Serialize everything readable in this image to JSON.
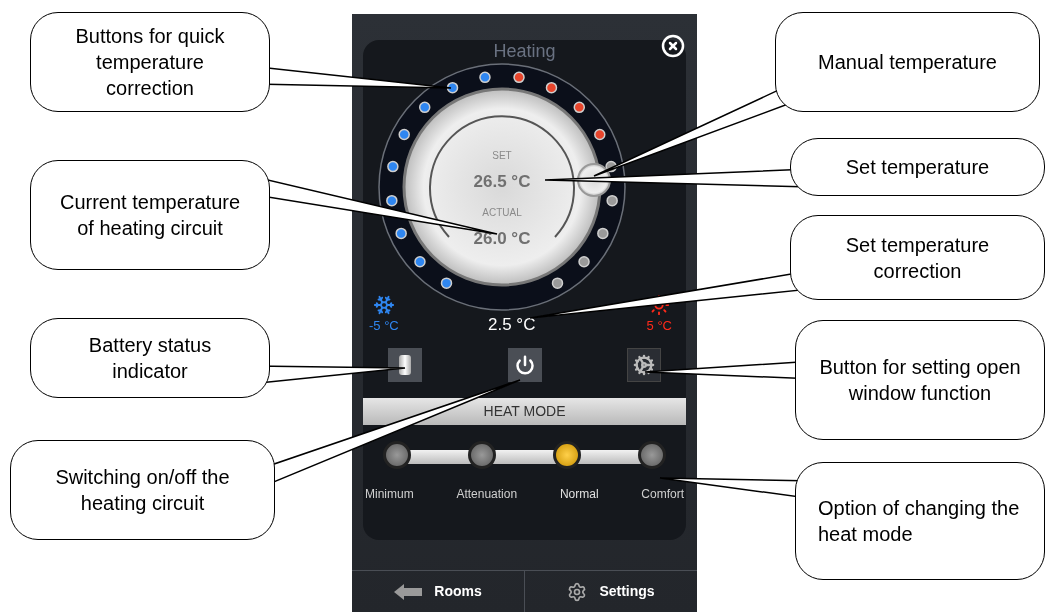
{
  "title": "Heating",
  "dial": {
    "set_label": "SET",
    "set_value": "26.5 °C",
    "actual_label": "ACTUAL",
    "actual_value": "26.0 °C",
    "correction": "2.5 °C",
    "dots": [
      {
        "color": "#2f86f0"
      },
      {
        "color": "#2f86f0"
      },
      {
        "color": "#2f86f0"
      },
      {
        "color": "#2f86f0"
      },
      {
        "color": "#2f86f0"
      },
      {
        "color": "#2f86f0"
      },
      {
        "color": "#2f86f0"
      },
      {
        "color": "#2f86f0"
      },
      {
        "color": "#2f86f0"
      },
      {
        "color": "#e8452c"
      },
      {
        "color": "#e8452c"
      },
      {
        "color": "#e8452c"
      },
      {
        "color": "#e8452c"
      },
      {
        "color": "#9a9a9a"
      },
      {
        "color": "#9a9a9a"
      },
      {
        "color": "#9a9a9a"
      },
      {
        "color": "#9a9a9a"
      },
      {
        "color": "#9a9a9a"
      }
    ]
  },
  "limits": [
    {
      "kind": "cold",
      "value": "-5 °C"
    },
    {
      "kind": "hot",
      "value": "5 °C"
    }
  ],
  "heat_mode": {
    "title": "HEAT MODE",
    "options": [
      {
        "label": "Minimum",
        "selected": false
      },
      {
        "label": "Attenuation",
        "selected": false
      },
      {
        "label": "Normal",
        "selected": true
      },
      {
        "label": "Comfort",
        "selected": false
      }
    ]
  },
  "nav": [
    {
      "kind": "back",
      "label": "Rooms"
    },
    {
      "kind": "settings",
      "label": "Settings"
    }
  ],
  "callouts": [
    {
      "text": "Buttons for quick temperature correction"
    },
    {
      "text": "Current temperature of heating circuit"
    },
    {
      "text": "Battery status indicator"
    },
    {
      "text": "Switching on/off the heating circuit"
    },
    {
      "text": "Manual temperature"
    },
    {
      "text": "Set temperature"
    },
    {
      "text": "Set temperature correction"
    },
    {
      "text": "Button for setting open window function"
    },
    {
      "text": "Option of changing the heat mode"
    }
  ]
}
